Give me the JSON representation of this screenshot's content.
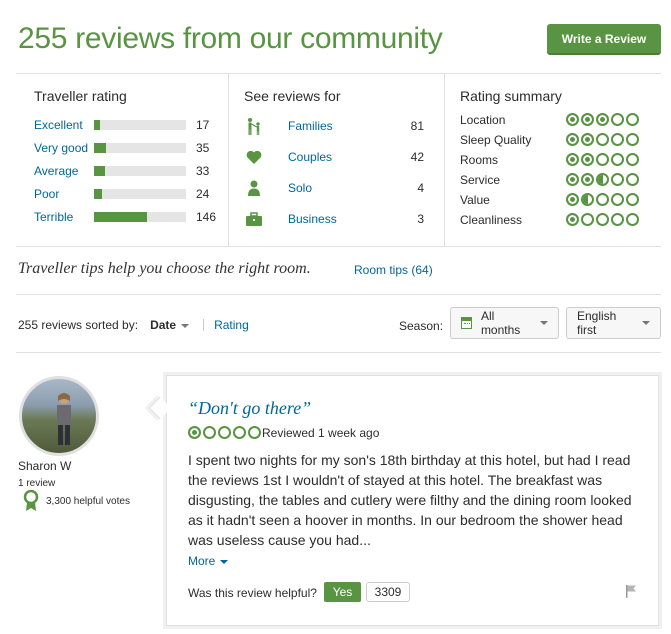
{
  "header": {
    "title": "255 reviews from our community",
    "write_review": "Write a Review"
  },
  "traveller_rating": {
    "title": "Traveller rating",
    "rows": [
      {
        "label": "Excellent",
        "count": "17",
        "fraction": 0.07
      },
      {
        "label": "Very good",
        "count": "35",
        "fraction": 0.13
      },
      {
        "label": "Average",
        "count": "33",
        "fraction": 0.12
      },
      {
        "label": "Poor",
        "count": "24",
        "fraction": 0.09
      },
      {
        "label": "Terrible",
        "count": "146",
        "fraction": 0.58
      }
    ]
  },
  "reviews_for": {
    "title": "See reviews for",
    "rows": [
      {
        "label": "Families",
        "count": "81",
        "icon": "family-icon"
      },
      {
        "label": "Couples",
        "count": "42",
        "icon": "heart-icon"
      },
      {
        "label": "Solo",
        "count": "4",
        "icon": "person-icon"
      },
      {
        "label": "Business",
        "count": "3",
        "icon": "briefcase-icon"
      }
    ]
  },
  "rating_summary": {
    "title": "Rating summary",
    "rows": [
      {
        "label": "Location",
        "rating": 3
      },
      {
        "label": "Sleep Quality",
        "rating": 2
      },
      {
        "label": "Rooms",
        "rating": 2
      },
      {
        "label": "Service",
        "rating": 2.5
      },
      {
        "label": "Value",
        "rating": 1.5
      },
      {
        "label": "Cleanliness",
        "rating": 1
      }
    ]
  },
  "tips": {
    "text": "Traveller tips help you choose the right room.",
    "link": "Room tips (64)"
  },
  "sort": {
    "prefix": "255 reviews sorted by:",
    "date": "Date",
    "rating": "Rating",
    "season_label": "Season:",
    "season_value": "All months",
    "language_value": "English first"
  },
  "review": {
    "reviewer_name": "Sharon W",
    "reviewer_reviews": "1 review",
    "helpful_votes": "3,300 helpful votes",
    "title": "“Don't go there”",
    "rating": 1,
    "date": "Reviewed 1 week ago",
    "text": "I spent two nights for my son's 18th birthday at this hotel, but had I read the reviews 1st I wouldn't of stayed at this hotel. The breakfast was disgusting, the tables and cutlery were filthy and the dining room looked as it hadn't seen a hoover in months. In our bedroom the shower head was useless cause you had...",
    "more": "More",
    "helpful_question": "Was this review helpful?",
    "yes": "Yes",
    "helpful_count": "3309"
  },
  "colors": {
    "brand_green": "#589442",
    "link_blue": "#006699"
  }
}
